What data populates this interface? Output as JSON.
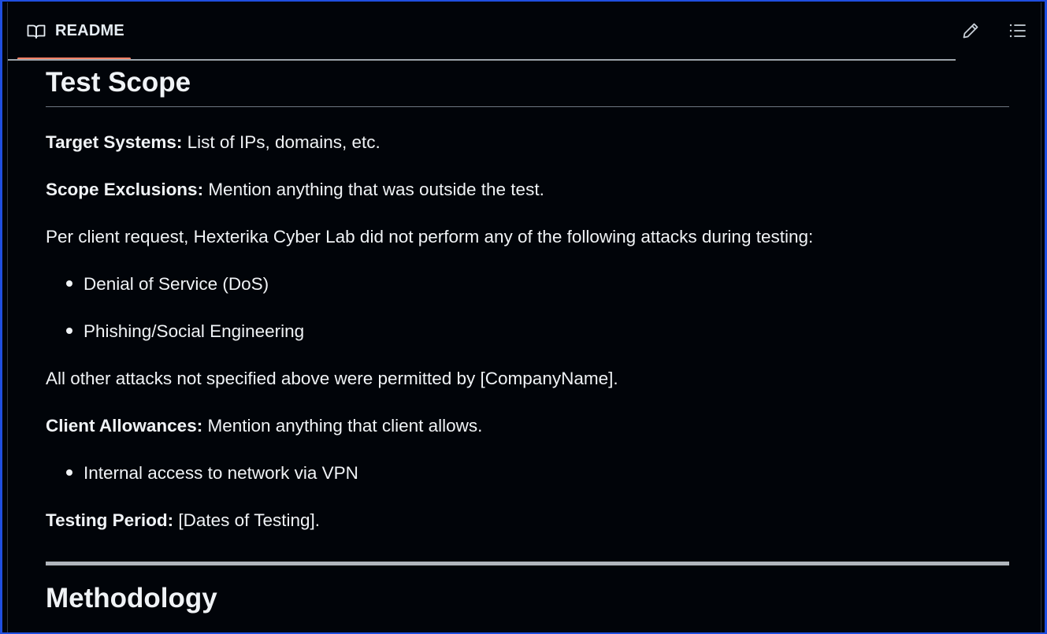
{
  "header": {
    "tab_label": "README",
    "tab_icon": "book-icon",
    "edit_icon": "pencil-icon",
    "toc_icon": "list-icon",
    "accent_color": "#f78166"
  },
  "content": {
    "section1_title": "Test Scope",
    "target_systems": {
      "label": "Target Systems:",
      "text": " List of IPs, domains, etc."
    },
    "scope_exclusions": {
      "label": "Scope Exclusions:",
      "text": " Mention anything that was outside the test."
    },
    "client_request": "Per client request, Hexterika Cyber Lab did not perform any of the following attacks during testing:",
    "excluded_attacks": [
      "Denial of Service (DoS)",
      "Phishing/Social Engineering"
    ],
    "permitted_note": "All other attacks not specified above were permitted by [CompanyName].",
    "client_allowances": {
      "label": "Client Allowances:",
      "text": " Mention anything that client allows."
    },
    "allowances": [
      "Internal access to network via VPN"
    ],
    "testing_period": {
      "label": "Testing Period:",
      "text": " [Dates of Testing]."
    },
    "section2_title": "Methodology"
  }
}
